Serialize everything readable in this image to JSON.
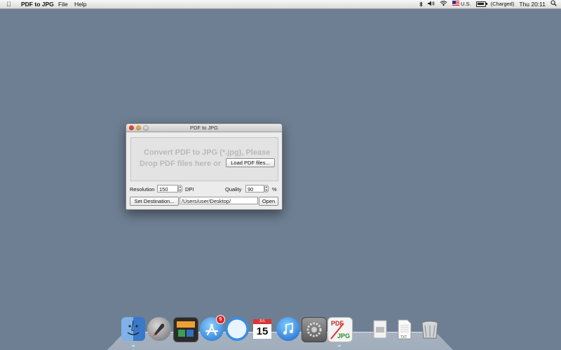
{
  "menubar": {
    "app_name": "PDF to JPG",
    "file": "File",
    "help": "Help",
    "language": "U.S.",
    "battery_status": "(Charged)",
    "clock": "Thu 20:11"
  },
  "window": {
    "title": "PDF to JPG",
    "drop_line1": "Convert PDF to JPG (*.jpg), Please",
    "drop_line2": "Drop PDF files here or",
    "load_button": "Load PDF files...",
    "resolution_label": "Resolution",
    "resolution_value": "150",
    "dpi_unit": "DPI",
    "quality_label": "Quality",
    "quality_value": "90",
    "quality_unit": "%",
    "set_destination_button": "Set Destination...",
    "destination_path": "/Users/user/Desktop/",
    "open_button": "Open"
  },
  "dock": {
    "app_store_badge": "5",
    "calendar_month": "JUL",
    "calendar_day": "15",
    "pdf_to_jpg_top": "PDF",
    "pdf_to_jpg_bottom": "JPG",
    "txt_label": "TXT"
  },
  "colors": {
    "desktop": "#6e7f93",
    "close": "#e0443e",
    "minimize": "#e0a93c"
  }
}
